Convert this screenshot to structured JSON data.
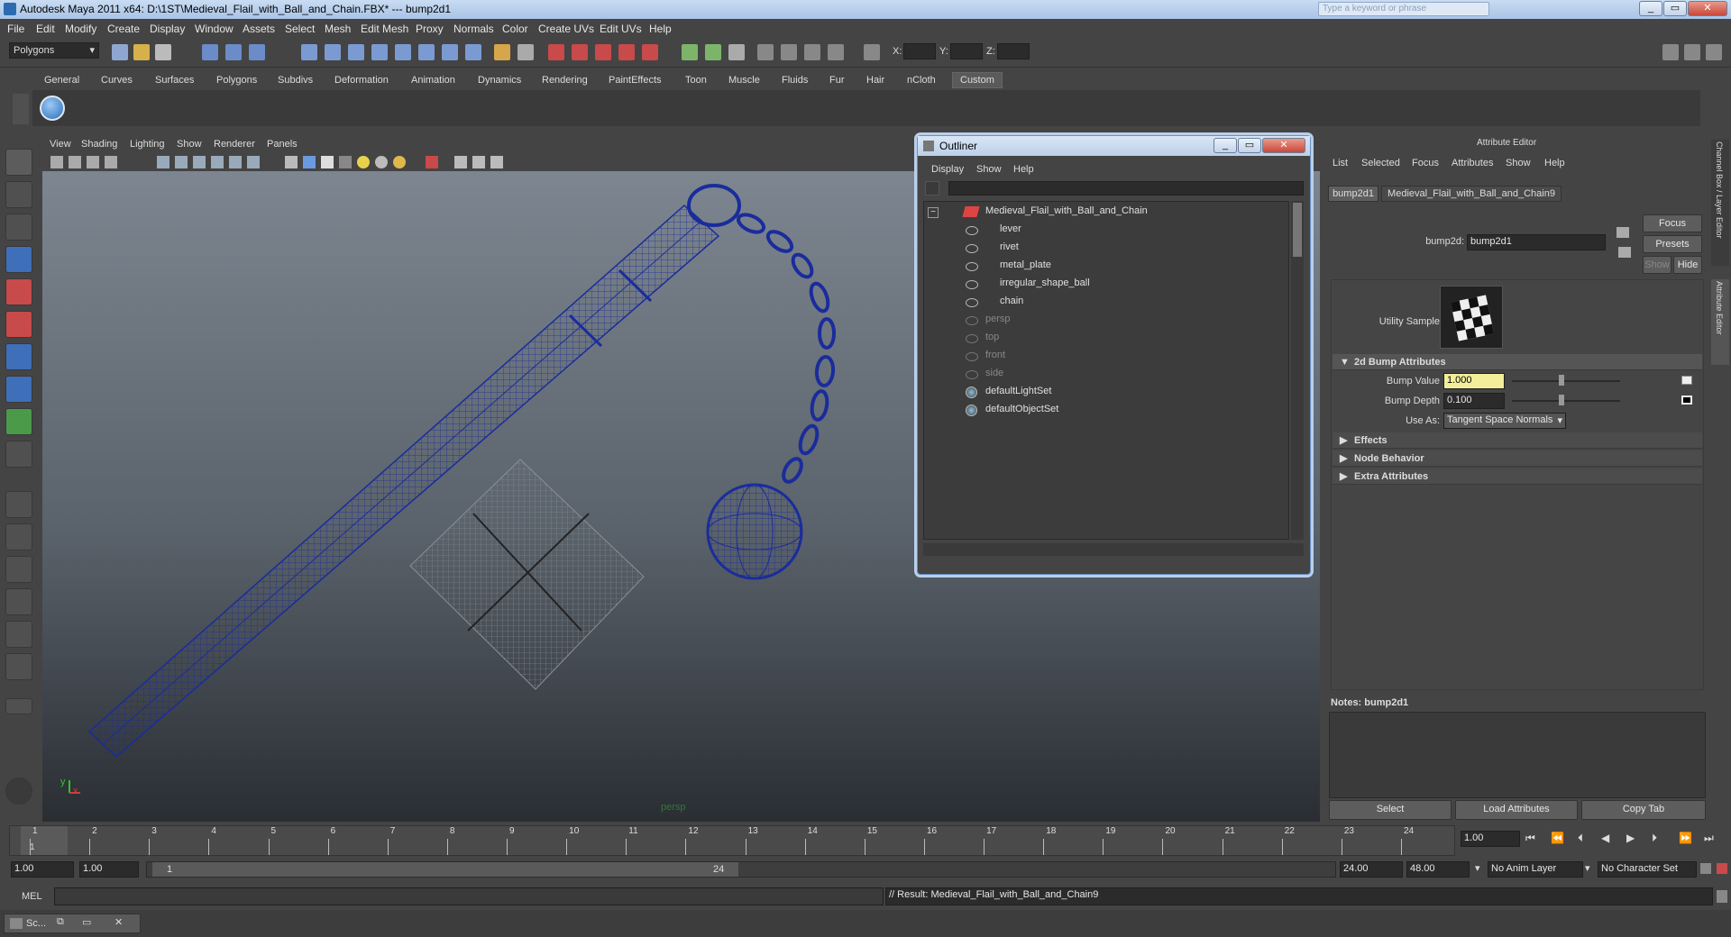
{
  "window": {
    "title": "Autodesk Maya 2011 x64: D:\\1ST\\Medieval_Flail_with_Ball_and_Chain.FBX*   ---   bump2d1",
    "search_placeholder": "Type a keyword or phrase"
  },
  "menubar": [
    "File",
    "Edit",
    "Modify",
    "Create",
    "Display",
    "Window",
    "Assets",
    "Select",
    "Mesh",
    "Edit Mesh",
    "Proxy",
    "Normals",
    "Color",
    "Create UVs",
    "Edit UVs",
    "Help"
  ],
  "toolbar": {
    "mode": "Polygons",
    "x_label": "X:",
    "y_label": "Y:",
    "z_label": "Z:"
  },
  "shelf_tabs": [
    "General",
    "Curves",
    "Surfaces",
    "Polygons",
    "Subdivs",
    "Deformation",
    "Animation",
    "Dynamics",
    "Rendering",
    "PaintEffects",
    "Toon",
    "Muscle",
    "Fluids",
    "Fur",
    "Hair",
    "nCloth",
    "Custom"
  ],
  "viewport": {
    "menu": [
      "View",
      "Shading",
      "Lighting",
      "Show",
      "Renderer",
      "Panels"
    ],
    "camera_label": "persp",
    "axis_x": "x",
    "axis_y": "y"
  },
  "outliner": {
    "title": "Outliner",
    "menu": [
      "Display",
      "Show",
      "Help"
    ],
    "items": [
      {
        "label": "Medieval_Flail_with_Ball_and_Chain",
        "level": 0,
        "dim": false
      },
      {
        "label": "lever",
        "level": 1,
        "dim": false
      },
      {
        "label": "rivet",
        "level": 1,
        "dim": false
      },
      {
        "label": "metal_plate",
        "level": 1,
        "dim": false
      },
      {
        "label": "irregular_shape_ball",
        "level": 1,
        "dim": false
      },
      {
        "label": "chain",
        "level": 1,
        "dim": false
      },
      {
        "label": "persp",
        "level": 0,
        "dim": true
      },
      {
        "label": "top",
        "level": 0,
        "dim": true
      },
      {
        "label": "front",
        "level": 0,
        "dim": true
      },
      {
        "label": "side",
        "level": 0,
        "dim": true
      },
      {
        "label": "defaultLightSet",
        "level": 0,
        "dim": false
      },
      {
        "label": "defaultObjectSet",
        "level": 0,
        "dim": false
      }
    ]
  },
  "attr_editor": {
    "title": "Attribute Editor",
    "menu": [
      "List",
      "Selected",
      "Focus",
      "Attributes",
      "Show",
      "Help"
    ],
    "tabs": [
      "bump2d1",
      "Medieval_Flail_with_Ball_and_Chain9"
    ],
    "node_label": "bump2d:",
    "node_value": "bump2d1",
    "focus": "Focus",
    "presets": "Presets",
    "show": "Show",
    "hide": "Hide",
    "sample_label": "Utility Sample",
    "section_2d": "2d Bump Attributes",
    "bump_value_label": "Bump Value",
    "bump_value": "1.000",
    "bump_depth_label": "Bump Depth",
    "bump_depth": "0.100",
    "use_as_label": "Use As:",
    "use_as": "Tangent Space Normals",
    "sections": [
      "Effects",
      "Node Behavior",
      "Extra Attributes"
    ],
    "notes": "Notes:  bump2d1",
    "buttons": [
      "Select",
      "Load Attributes",
      "Copy Tab"
    ],
    "side_tabs": [
      "Channel Box / Layer Editor",
      "Attribute Editor"
    ]
  },
  "timeline": {
    "ticks": [
      "1",
      "2",
      "3",
      "4",
      "5",
      "6",
      "7",
      "8",
      "9",
      "10",
      "11",
      "12",
      "13",
      "14",
      "15",
      "16",
      "17",
      "18",
      "19",
      "20",
      "21",
      "22",
      "23",
      "24"
    ],
    "current_frame": "1.00",
    "range_start": "1.00",
    "range_start2": "1.00",
    "range_slider_start": "1",
    "range_slider_end": "24",
    "range_end": "24.00",
    "range_end2": "48.00",
    "anim_layer": "No Anim Layer",
    "char_set": "No Character Set"
  },
  "command": {
    "lang": "MEL",
    "result": "// Result: Medieval_Flail_with_Ball_and_Chain9"
  },
  "taskbar": {
    "item": "Sc..."
  }
}
